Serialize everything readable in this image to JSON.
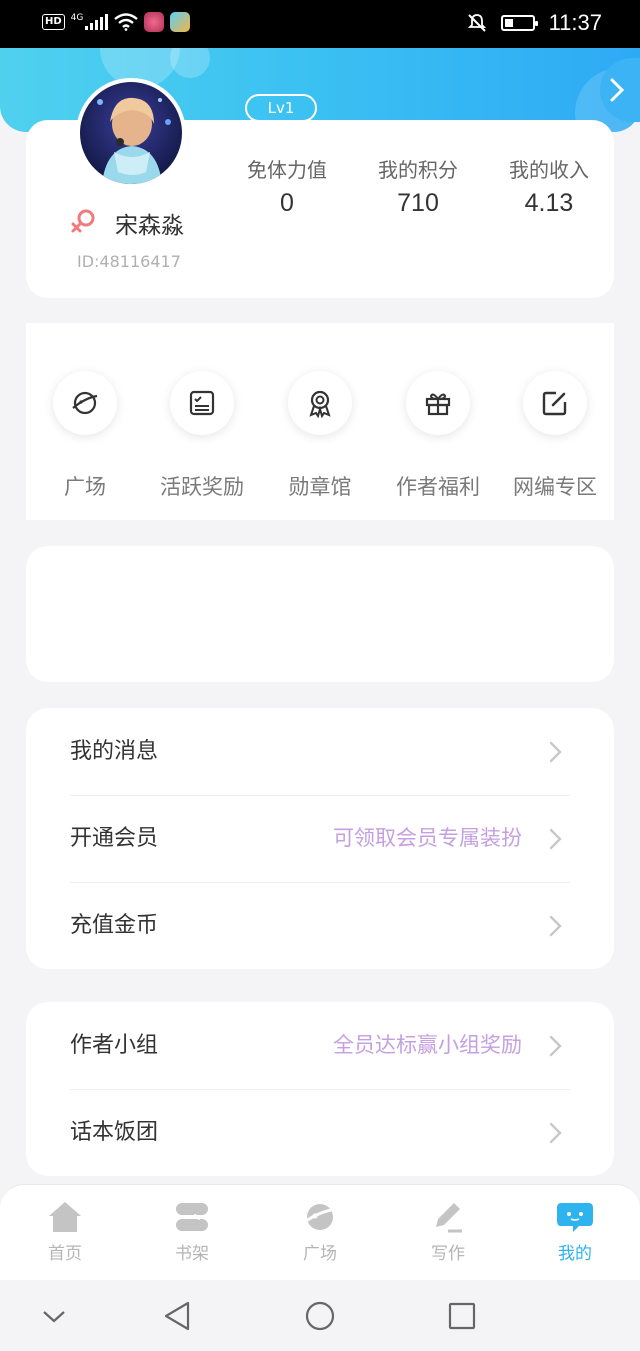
{
  "status_bar": {
    "network_badge": "HD",
    "network_type": "4G",
    "time": "11:37",
    "icons": [
      "signal-icon",
      "wifi-icon",
      "app-notification-icon",
      "app-notification-icon",
      "mute-icon",
      "battery-icon"
    ]
  },
  "header": {
    "expand_icon": "chevron-right-icon"
  },
  "profile": {
    "level": "Lv1",
    "gender_icon": "female-icon",
    "name": "宋森淼",
    "id": "ID:48116417",
    "stats": [
      {
        "label": "免体力值",
        "value": "0"
      },
      {
        "label": "我的积分",
        "value": "710"
      },
      {
        "label": "我的收入",
        "value": "4.13"
      }
    ]
  },
  "quick_actions": [
    {
      "label": "广场",
      "icon": "planet-icon"
    },
    {
      "label": "活跃奖励",
      "icon": "checklist-icon"
    },
    {
      "label": "勋章馆",
      "icon": "medal-icon"
    },
    {
      "label": "作者福利",
      "icon": "gift-icon"
    },
    {
      "label": "网编专区",
      "icon": "edit-icon"
    }
  ],
  "menu_group_1": [
    {
      "label": "我的消息",
      "hint": ""
    },
    {
      "label": "开通会员",
      "hint": "可领取会员专属装扮"
    },
    {
      "label": "充值金币",
      "hint": ""
    }
  ],
  "menu_group_2": [
    {
      "label": "作者小组",
      "hint": "全员达标赢小组奖励"
    },
    {
      "label": "话本饭团",
      "hint": ""
    }
  ],
  "tabbar": {
    "items": [
      {
        "label": "首页",
        "icon": "home-icon",
        "active": false
      },
      {
        "label": "书架",
        "icon": "bookshelf-icon",
        "active": false
      },
      {
        "label": "广场",
        "icon": "planet-icon",
        "active": false
      },
      {
        "label": "写作",
        "icon": "pen-icon",
        "active": false
      },
      {
        "label": "我的",
        "icon": "chat-bubble-icon",
        "active": true
      }
    ],
    "active_color": "#2fb3ee",
    "inactive_color": "#b5b5b5"
  },
  "colors": {
    "header_gradient_start": "#4fd1ee",
    "header_gradient_end": "#2eaaf5",
    "hint_purple": "#c5a0e0",
    "gender_pink": "#f27a7a"
  }
}
